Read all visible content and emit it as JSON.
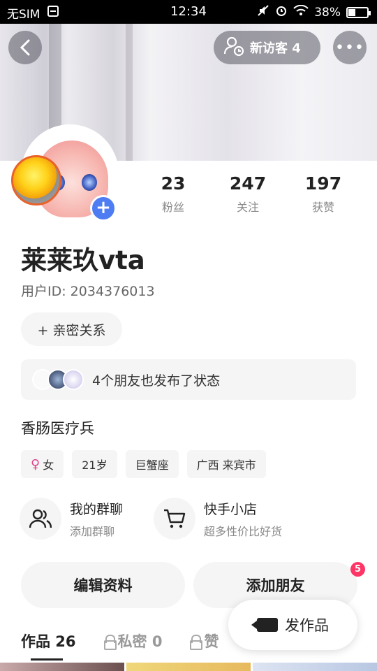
{
  "status_bar": {
    "carrier": "无SIM",
    "time": "12:34",
    "battery": "38%",
    "battery_level": 0.38
  },
  "header": {
    "back_label": "<",
    "visitor_label": "新访客 4",
    "more_label": "•••"
  },
  "profile": {
    "name": "莱莱玖vta",
    "user_id": "用户ID: 2034376013",
    "bio": "香肠医疗兵"
  },
  "stats": [
    {
      "num": "23",
      "label": "粉丝"
    },
    {
      "num": "247",
      "label": "关注"
    },
    {
      "num": "197",
      "label": "获赞"
    }
  ],
  "relation_button": "+ 亲密关系",
  "friends_status": "4个朋友也发布了状态",
  "tags": {
    "gender": "女",
    "age": "21岁",
    "zodiac": "巨蟹座",
    "location": "广西 来宾市"
  },
  "features": [
    {
      "title": "我的群聊",
      "subtitle": "添加群聊"
    },
    {
      "title": "快手小店",
      "subtitle": "超多性价比好货"
    }
  ],
  "actions": {
    "edit_profile": "编辑资料",
    "add_friend": "添加朋友",
    "add_friend_badge": "5"
  },
  "tabs": [
    {
      "label": "作品 26"
    },
    {
      "label": "私密 0"
    },
    {
      "label": "赞"
    }
  ],
  "publish_button": "发作品"
}
